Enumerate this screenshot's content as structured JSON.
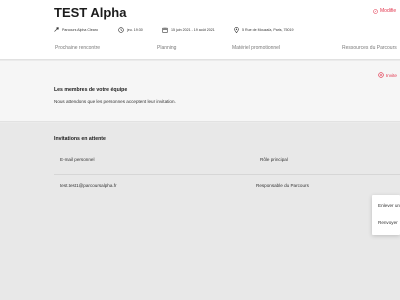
{
  "header": {
    "title": "TEST Alpha",
    "action_label": "Modifie",
    "meta": {
      "route": "Parcours Alpha Clearo",
      "time": "jeu. 19:30",
      "dates": "15 juin 2021 - 19 août 2021",
      "address": "5 Rue de Mouzaïa, Paris, 75019"
    }
  },
  "tabs": [
    "Prochaine rencontre",
    "Planning",
    "Matériel promotionnel",
    "Ressources du Parcours"
  ],
  "team": {
    "title": "Les membres de votre équipe",
    "description": "Nous attendons que les personnes acceptent leur invitation.",
    "invite_label": "Invite"
  },
  "pending": {
    "title": "Invitations en attente",
    "columns": [
      "E-mail personnel",
      "Rôle principal"
    ],
    "rows": [
      {
        "email": "test.test1@parcoursalpha.fr",
        "role": "Responsable du Parcours"
      }
    ]
  },
  "context_menu": {
    "items": [
      "Enlever un",
      "Renvoyer"
    ]
  },
  "colors": {
    "accent": "#e2334b",
    "header_bg": "#ffffff",
    "page_bg": "#ebebeb"
  }
}
